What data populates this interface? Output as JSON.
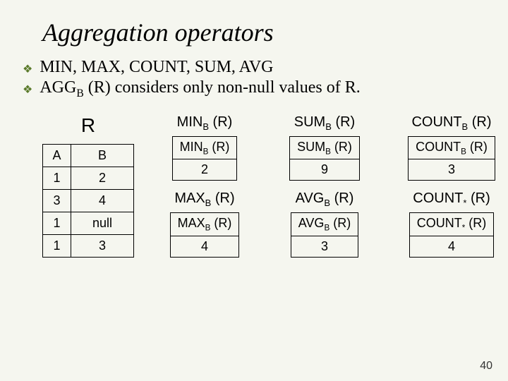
{
  "title": "Aggregation operators",
  "bullets": {
    "b1": "MIN, MAX, COUNT, SUM, AVG",
    "b2_pre": "AGG",
    "b2_sub": "B",
    "b2_post": " (R) considers only non-null values of R."
  },
  "relation": {
    "name": "R",
    "headers": {
      "a": "A",
      "b": "B"
    },
    "rows": [
      {
        "a": "1",
        "b": "2"
      },
      {
        "a": "3",
        "b": "4"
      },
      {
        "a": "1",
        "b": "null"
      },
      {
        "a": "1",
        "b": "3"
      }
    ]
  },
  "ops": {
    "min": {
      "title_pre": "MIN",
      "title_sub": "B",
      "title_post": " (R)",
      "hdr_pre": "MIN",
      "hdr_sub": "B",
      "hdr_post": " (R)",
      "val": "2"
    },
    "sum": {
      "title_pre": "SUM",
      "title_sub": "B",
      "title_post": " (R)",
      "hdr_pre": "SUM",
      "hdr_sub": "B",
      "hdr_post": " (R)",
      "val": "9"
    },
    "cntb": {
      "title_pre": "COUNT",
      "title_sub": "B",
      "title_post": " (R)",
      "hdr_pre": "COUNT",
      "hdr_sub": "B",
      "hdr_post": " (R)",
      "val": "3"
    },
    "max": {
      "title_pre": "MAX",
      "title_sub": "B",
      "title_post": " (R)",
      "hdr_pre": "MAX",
      "hdr_sub": "B",
      "hdr_post": " (R)",
      "val": "4"
    },
    "avg": {
      "title_pre": "AVG",
      "title_sub": "B",
      "title_post": " (R)",
      "hdr_pre": "AVG",
      "hdr_sub": "B",
      "hdr_post": " (R)",
      "val": "3"
    },
    "cnts": {
      "title_pre": "COUNT",
      "title_sub": "*",
      "title_post": " (R)",
      "hdr_pre": "COUNT",
      "hdr_sub": "*",
      "hdr_post": " (R)",
      "val": "4"
    }
  },
  "page": "40"
}
